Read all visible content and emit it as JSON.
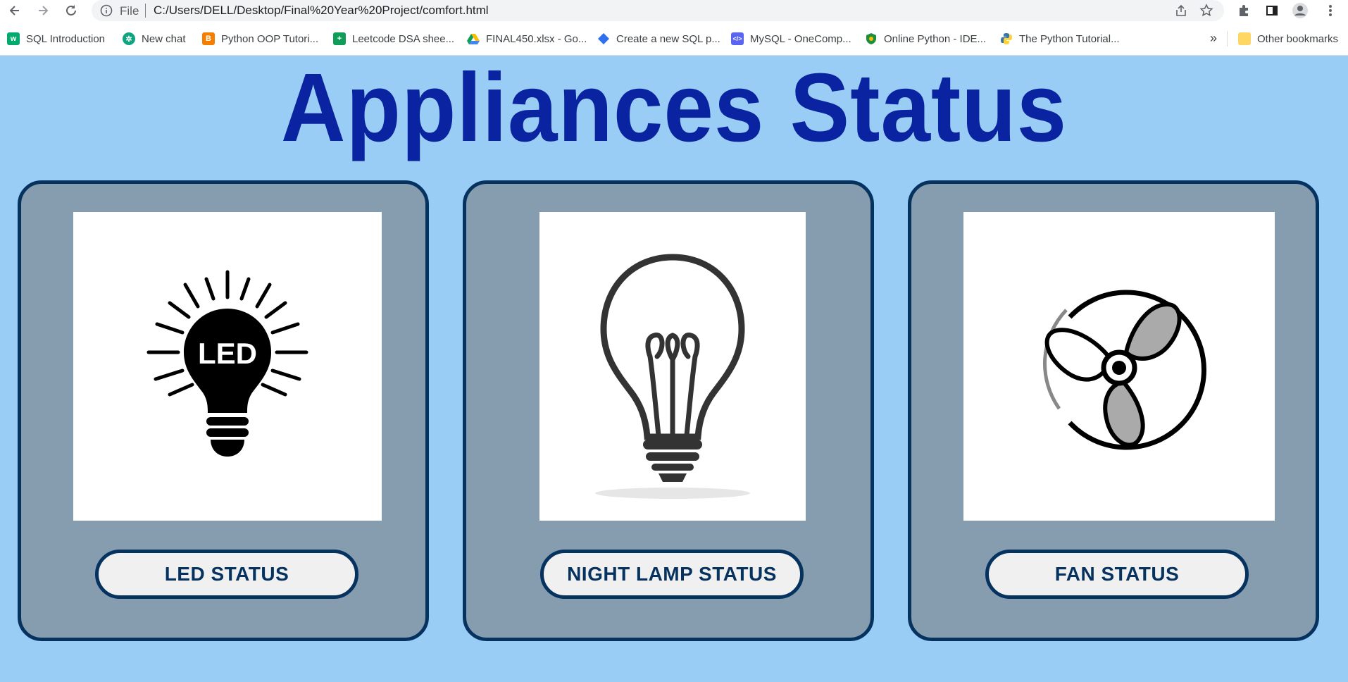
{
  "browser": {
    "file_label": "File",
    "url": "C:/Users/DELL/Desktop/Final%20Year%20Project/comfort.html",
    "bookmarks": [
      {
        "label": "SQL Introduction",
        "icon": "w3schools-icon",
        "color": "#04aa6d"
      },
      {
        "label": "New chat",
        "icon": "chatgpt-icon",
        "color": "#10a37f"
      },
      {
        "label": "Python OOP Tutori...",
        "icon": "blogger-icon",
        "color": "#f57d00"
      },
      {
        "label": "Leetcode DSA shee...",
        "icon": "sheets-icon",
        "color": "#0f9d58"
      },
      {
        "label": "FINAL450.xlsx - Go...",
        "icon": "drive-icon",
        "color": "#fbbc04"
      },
      {
        "label": "Create a new SQL p...",
        "icon": "diamond-icon",
        "color": "#2f6ff0"
      },
      {
        "label": "MySQL - OneComp...",
        "icon": "code-icon",
        "color": "#5865f2"
      },
      {
        "label": "Online Python - IDE...",
        "icon": "shield-icon",
        "color": "#1e8e3e"
      },
      {
        "label": "The Python Tutorial...",
        "icon": "python-icon",
        "color": "#3776ab"
      }
    ],
    "more_label": "»",
    "other_bookmarks": "Other bookmarks"
  },
  "page": {
    "title": "Appliances Status",
    "cards": [
      {
        "button": "LED STATUS",
        "image_text": "LED",
        "icon": "led-bulb-icon"
      },
      {
        "button": "NIGHT LAMP STATUS",
        "icon": "light-bulb-icon"
      },
      {
        "button": "FAN STATUS",
        "icon": "fan-icon"
      }
    ]
  },
  "colors": {
    "background": "#99cdf5",
    "title": "#0a23a0",
    "card": "#869db0",
    "border": "#06325f",
    "button": "#f0f0f0"
  }
}
